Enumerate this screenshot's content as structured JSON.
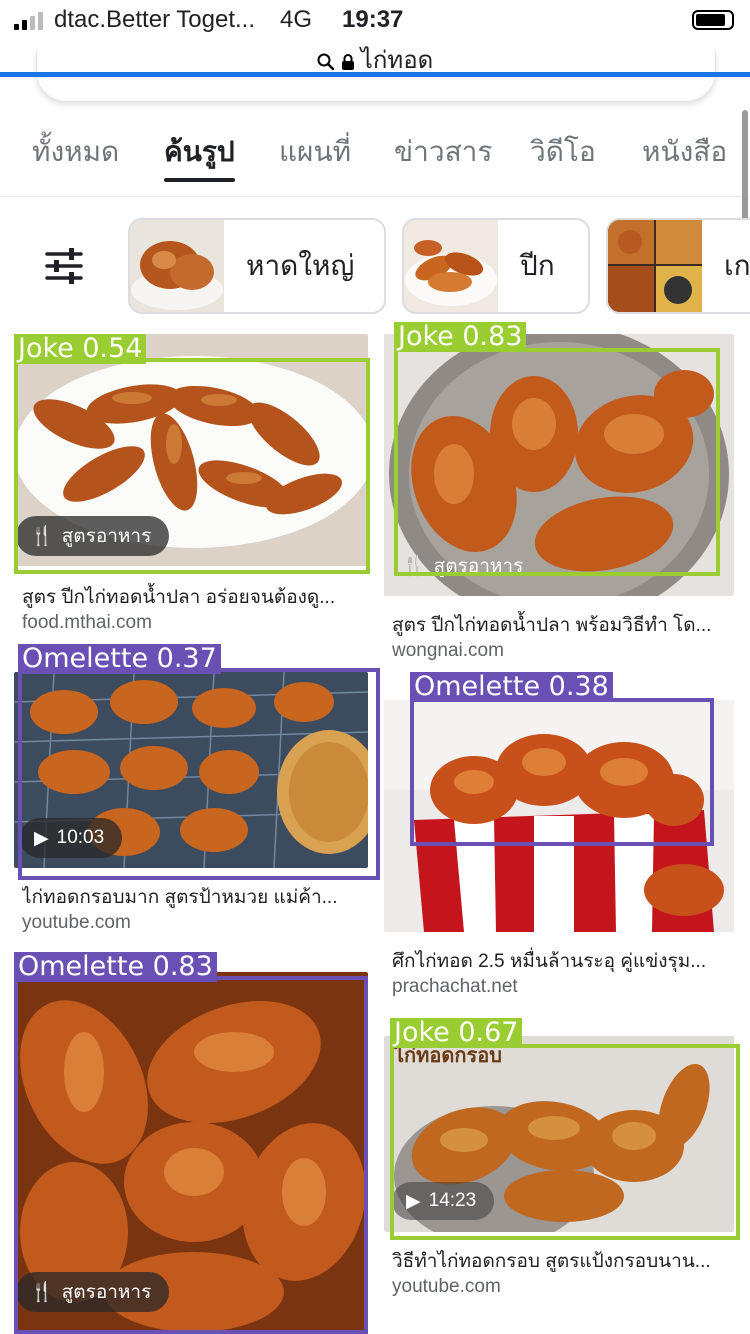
{
  "status_bar": {
    "carrier": "dtac.Better Toget...",
    "network": "4G",
    "time": "19:37"
  },
  "url_bar": {
    "text": "ไก่ทอด"
  },
  "tabs": [
    {
      "label": "ทั้งหมด"
    },
    {
      "label": "ค้นรูป",
      "active": true
    },
    {
      "label": "แผนที่"
    },
    {
      "label": "ข่าวสาร"
    },
    {
      "label": "วิดีโอ"
    },
    {
      "label": "หนังสือ"
    }
  ],
  "chips": [
    {
      "label": "หาดใหญ่"
    },
    {
      "label": "ปีก"
    },
    {
      "label": "เก"
    }
  ],
  "results": [
    {
      "caption": "สูตร ปีกไก่ทอดน้ำปลา อร่อยจนต้องดู...",
      "source": "food.mthai.com",
      "badge": "สูตรอาหาร"
    },
    {
      "caption": "สูตร ปีกไก่ทอดน้ำปลา พร้อมวิธีทำ โด...",
      "source": "wongnai.com",
      "badge": "สูตรอาหาร"
    },
    {
      "caption": "ไก่ทอดกรอบมาก สูตรป้าหมวย แม่ค้า...",
      "source": "youtube.com",
      "badge": "10:03"
    },
    {
      "caption": "ศึกไก่ทอด 2.5 หมื่นล้านระอุ คู่แข่งรุม...",
      "source": "prachachat.net"
    },
    {
      "badge": "สูตรอาหาร"
    },
    {
      "caption": "วิธีทำไก่ทอดกรอบ สูตรแป้งกรอบนาน...",
      "source": "youtube.com",
      "badge": "14:23",
      "image_text": "ไก่ทอดกรอบ"
    }
  ],
  "detections": [
    {
      "label": "Joke 0.54",
      "class": "joke"
    },
    {
      "label": "Joke 0.83",
      "class": "joke"
    },
    {
      "label": "Omelette 0.37",
      "class": "omelette"
    },
    {
      "label": "Omelette 0.38",
      "class": "omelette"
    },
    {
      "label": "Omelette 0.83",
      "class": "omelette"
    },
    {
      "label": "Joke 0.67",
      "class": "joke"
    }
  ],
  "colors": {
    "accent": "#1a73e8",
    "joke_box": "#9acd32",
    "omelette_box": "#6a4fb5"
  }
}
